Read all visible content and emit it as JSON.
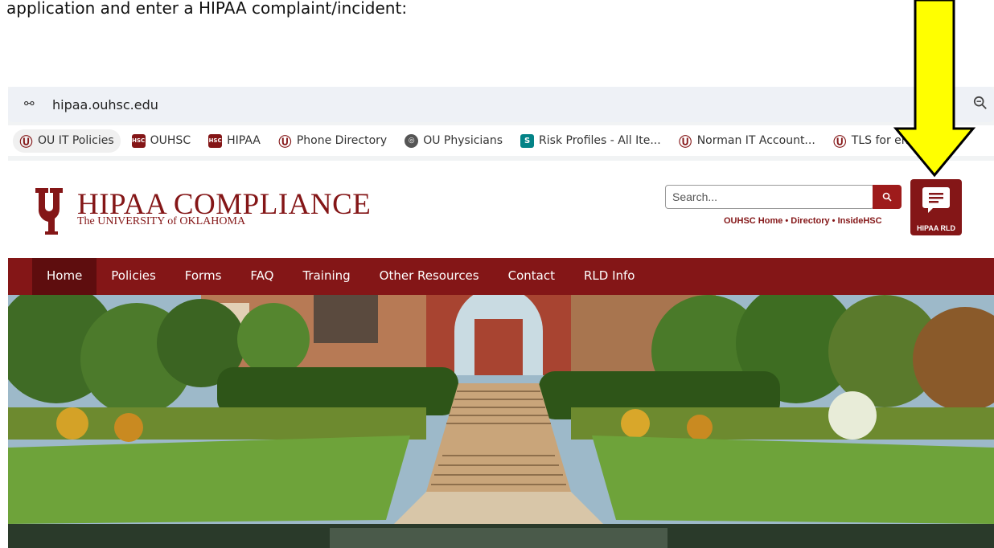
{
  "document": {
    "text": "application and enter a HIPAA complaint/incident:"
  },
  "browser": {
    "url": "hipaa.ouhsc.edu",
    "bookmarks": [
      {
        "label": "OU IT Policies",
        "icon": "ou-logo-icon"
      },
      {
        "label": "OUHSC",
        "icon": "hsc-logo-icon"
      },
      {
        "label": "HIPAA",
        "icon": "hsc-logo-icon"
      },
      {
        "label": "Phone Directory",
        "icon": "ou-logo-icon"
      },
      {
        "label": "OU Physicians",
        "icon": "globe-icon"
      },
      {
        "label": "Risk Profiles - All Ite...",
        "icon": "sharepoint-icon"
      },
      {
        "label": "Norman IT Account...",
        "icon": "ou-logo-icon"
      },
      {
        "label": "TLS for ema",
        "icon": "ou-logo-icon"
      }
    ]
  },
  "site": {
    "title": "HIPAA COMPLIANCE",
    "subtitle": "The UNIVERSITY of OKLAHOMA",
    "search_placeholder": "Search...",
    "utility_links": "OUHSC Home • Directory • InsideHSC",
    "rld_label": "HIPAA RLD",
    "brand_color": "#841617"
  },
  "nav": {
    "items": [
      "Home",
      "Policies",
      "Forms",
      "FAQ",
      "Training",
      "Other Resources",
      "Contact",
      "RLD Info"
    ],
    "active": "Home"
  },
  "annotation": {
    "arrow_color": "#ffff00"
  }
}
